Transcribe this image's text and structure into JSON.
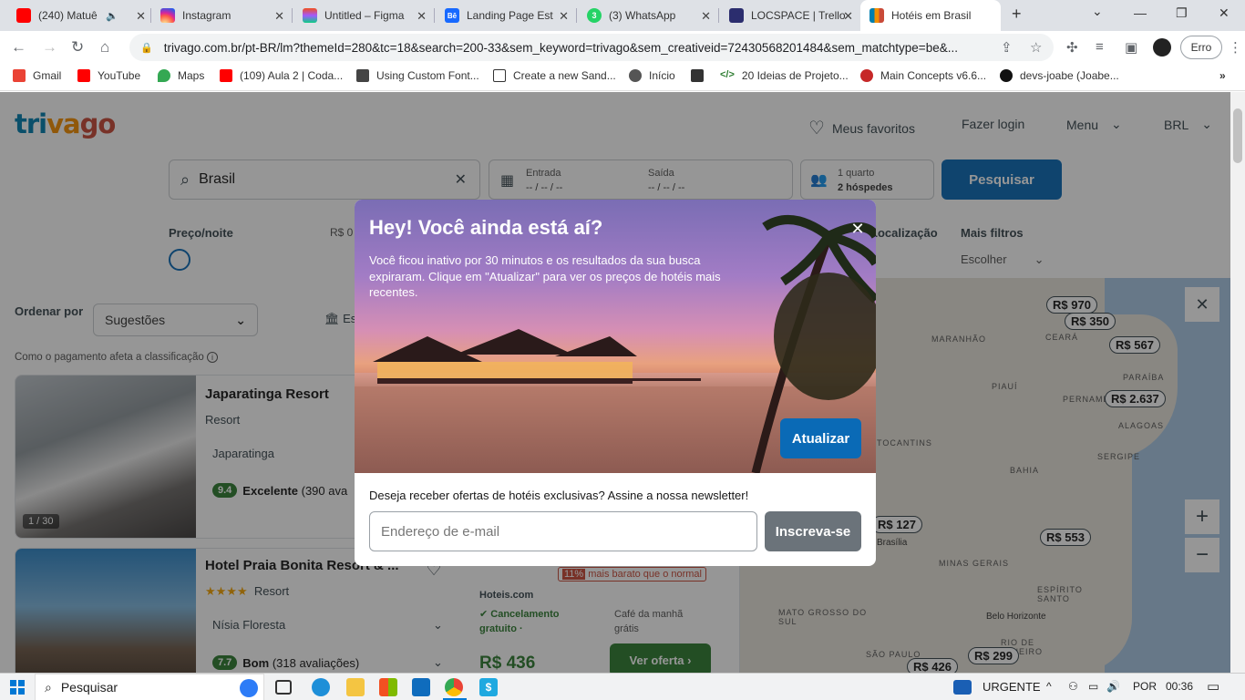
{
  "browser": {
    "tabs": [
      {
        "title": "(240) Matuê",
        "icon": "youtube-icon",
        "color": "#ff0000"
      },
      {
        "title": "Instagram",
        "icon": "instagram-icon",
        "color": "#d6249f"
      },
      {
        "title": "Untitled – Figma",
        "icon": "figma-icon",
        "color": "#a259ff"
      },
      {
        "title": "Landing Page Est",
        "icon": "behance-icon",
        "color": "#1769ff"
      },
      {
        "title": "(3) WhatsApp",
        "icon": "whatsapp-icon",
        "color": "#25d366"
      },
      {
        "title": "LOCSPACE | Trello",
        "icon": "locspace-icon",
        "color": "#2b2d6e"
      },
      {
        "title": "Hotéis em Brasil",
        "icon": "trivago-icon",
        "color": "#f48f00"
      }
    ],
    "url": "trivago.com.br/pt-BR/lm?themeId=280&tc=18&search=200-33&sem_keyword=trivago&sem_creativeid=72430568201484&sem_matchtype=be&...",
    "erro_label": "Erro",
    "bookmarks": [
      {
        "label": "Gmail",
        "color": "#ea4335"
      },
      {
        "label": "YouTube",
        "color": "#ff0000"
      },
      {
        "label": "Maps",
        "color": "#34a853"
      },
      {
        "label": "(109) Aula 2 | Coda...",
        "color": "#ff0000"
      },
      {
        "label": "Using Custom Font...",
        "color": "#444444"
      },
      {
        "label": "Create a new Sand...",
        "color": "#ffffff"
      },
      {
        "label": "Início",
        "color": "#555555"
      },
      {
        "label": "",
        "color": "#333333"
      },
      {
        "label": "20 Ideias de Projeto...",
        "color": "#2e7d32"
      },
      {
        "label": "Main Concepts v6.6...",
        "color": "#c62828"
      },
      {
        "label": "devs-joabe (Joabe...",
        "color": "#111111"
      }
    ]
  },
  "header": {
    "favorites": "Meus favoritos",
    "login": "Fazer login",
    "menu": "Menu",
    "currency": "BRL"
  },
  "search": {
    "destination": "Brasil",
    "checkin_label": "Entrada",
    "checkin_value": "-- / -- / --",
    "checkout_label": "Saída",
    "checkout_value": "-- / -- / --",
    "rooms": "1 quarto",
    "guests": "2 hóspedes",
    "button": "Pesquisar"
  },
  "filters": {
    "price_label": "Preço/noite",
    "price_min": "R$ 0",
    "location_label": "Localização",
    "more_label": "Mais filtros",
    "more_value": "Escolher"
  },
  "sort": {
    "label": "Ordenar por",
    "value": "Sugestões",
    "note": "Como o pagamento afeta a classificação",
    "view_label": "Es"
  },
  "hotels": [
    {
      "name": "Japaratinga Resort",
      "type": "Resort",
      "location": "Japaratinga",
      "score": "9.4",
      "rating_text": "Excelente",
      "reviews": "(390 ava",
      "photo_count": "1 / 30"
    },
    {
      "name": "Hotel Praia Bonita Resort & ...",
      "stars": "★★★★",
      "type": "Resort",
      "location": "Nísia Floresta",
      "score": "7.7",
      "rating_text": "Bom",
      "reviews": "(318 avaliações)",
      "discount": "11%",
      "discount_text": "mais barato que o normal",
      "provider": "Hoteis.com",
      "cancel": "Cancelamento gratuito ·",
      "breakfast": "Café da manhã grátis",
      "price": "R$ 436",
      "offer_button": "Ver oferta"
    }
  ],
  "map": {
    "pins": [
      "R$ 970",
      "R$ 350",
      "R$ 567",
      "R$ 2.637",
      "R$ 127",
      "R$ 553",
      "R$ 426",
      "R$ 299"
    ],
    "labels": [
      "MARANHÃO",
      "CEARÁ",
      "PIAUÍ",
      "PARAÍBA",
      "PERNAMBUCO",
      "ALAGOAS",
      "TOCANTINS",
      "SERGIPE",
      "BAHIA",
      "Brasília",
      "MINAS GERAIS",
      "ESPÍRITO SANTO",
      "MATO GROSSO DO SUL",
      "Belo Horizonte",
      "SÃO PAULO",
      "RIO DE JANEIRO"
    ]
  },
  "modal": {
    "title": "Hey! Você ainda está aí?",
    "description": "Você ficou inativo por 30 minutos e os resultados da sua busca expiraram. Clique em \"Atualizar\" para ver os preços de hotéis mais recentes.",
    "update_button": "Atualizar",
    "newsletter_text": "Deseja receber ofertas de hotéis exclusivas? Assine a nossa newsletter!",
    "email_placeholder": "Endereço de e-mail",
    "subscribe_button": "Inscreva-se"
  },
  "taskbar": {
    "search_placeholder": "Pesquisar",
    "news": "URGENTE",
    "lang": "POR",
    "time": "00:36"
  }
}
